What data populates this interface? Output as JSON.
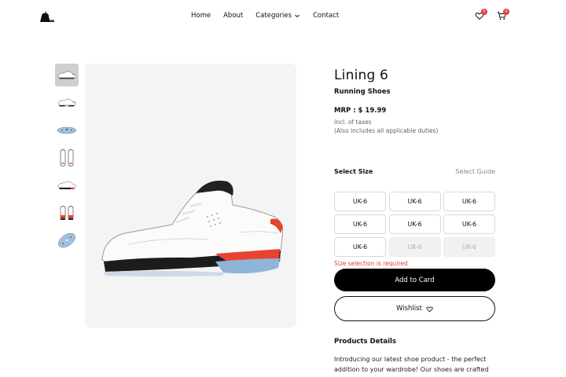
{
  "header": {
    "logo": "cat-logo-icon",
    "nav": [
      {
        "label": "Home"
      },
      {
        "label": "About"
      },
      {
        "label": "Categories",
        "icon": "chevron-down-icon"
      },
      {
        "label": "Contact"
      }
    ],
    "wishlist_badge": "0",
    "cart_badge": "0"
  },
  "gallery": {
    "thumbnails": [
      "side-view",
      "side-view",
      "sole-view",
      "front-view",
      "side-view",
      "heel-view",
      "sole-view"
    ],
    "active_index": 0
  },
  "product": {
    "title": "Lining 6",
    "subtitle": "Running Shoes",
    "price": "MRP : $ 19.99",
    "tax_note": "incl. of taxes",
    "duty_note": "(Also includes all applicable duties)",
    "size_label": "Select Size",
    "size_guide": "Select Guide",
    "sizes": [
      {
        "label": "UK-6",
        "available": true
      },
      {
        "label": "UK-6",
        "available": true
      },
      {
        "label": "UK-6",
        "available": true
      },
      {
        "label": "UK-6",
        "available": true
      },
      {
        "label": "UK-6",
        "available": true
      },
      {
        "label": "UK-6",
        "available": true
      },
      {
        "label": "UK-6",
        "available": true
      },
      {
        "label": "UK-6",
        "available": false
      },
      {
        "label": "UK-6",
        "available": false
      }
    ],
    "size_error": "Size selection is required",
    "add_button": "Add to Card",
    "wishlist_button": "Wishlist",
    "details_title": "Products Details",
    "details_text": "Introducing our latest shoe product - the perfect addition to your wardrobe! Our shoes are crafted"
  },
  "colors": {
    "accent": "#000000",
    "error": "#e0413f",
    "badge": "#e23b3b",
    "image_bg": "#f4f4f4"
  }
}
